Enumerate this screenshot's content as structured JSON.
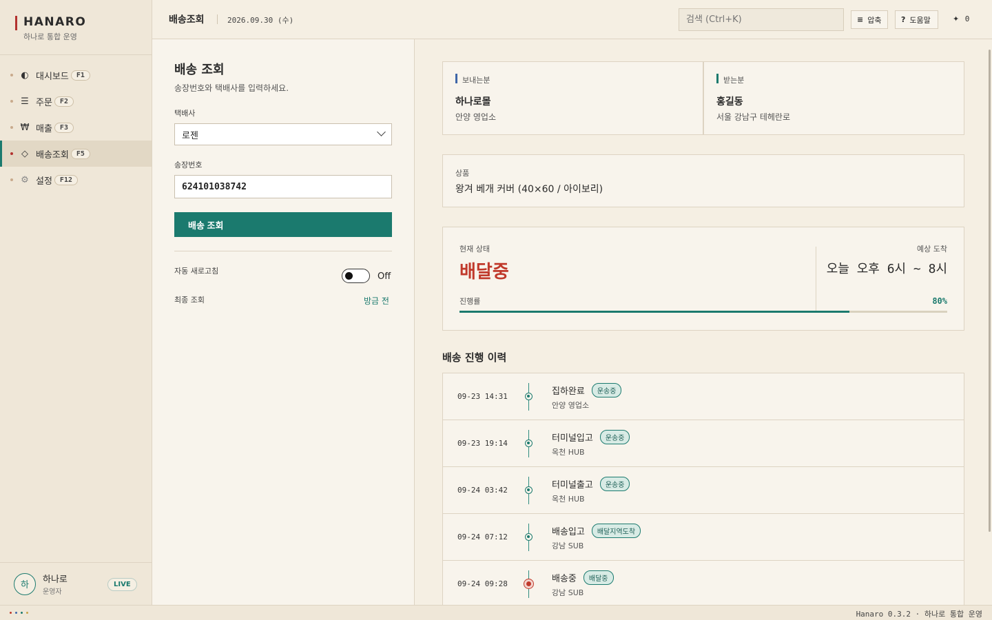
{
  "brand": {
    "name": "HANARO",
    "subtitle": "하나로 통합 운영"
  },
  "sidebar": {
    "items": [
      {
        "icon": "◐",
        "label": "대시보드",
        "key": "F1"
      },
      {
        "icon": "☰",
        "label": "주문",
        "key": "F2"
      },
      {
        "icon": "₩",
        "label": "매출",
        "key": "F3"
      },
      {
        "icon": "◇",
        "label": "배송조회",
        "key": "F5"
      },
      {
        "icon": "⚙",
        "label": "설정",
        "key": "F12"
      }
    ],
    "active_index": 3
  },
  "user": {
    "avatar": "하",
    "name": "하나로",
    "role": "운영자",
    "status": "LIVE"
  },
  "header": {
    "title": "배송조회",
    "date": "2026.09.30 (수)",
    "search_placeholder": "검색 (Ctrl+K)",
    "compress_icon": "≡",
    "compress_label": "압축",
    "help_icon": "?",
    "help_label": "도움말",
    "spark_icon": "✦",
    "spark_count": "0"
  },
  "form": {
    "title": "배송 조회",
    "description": "송장번호와 택배사를 입력하세요.",
    "carrier_label": "택배사",
    "carrier_value": "로젠",
    "tracking_label": "송장번호",
    "tracking_value": "624101038742",
    "submit_label": "배송 조회",
    "auto_refresh_label": "자동 새로고침",
    "auto_refresh_state": "Off",
    "last_query_label": "최종 조회",
    "last_query_value": "방금 전"
  },
  "sender": {
    "label": "보내는분",
    "name": "하나로몰",
    "address": "안양 영업소"
  },
  "receiver": {
    "label": "받는분",
    "name": "홍길동",
    "address": "서울 강남구 테헤란로"
  },
  "product": {
    "label": "상품",
    "name": "왕겨 베개 커버 (40×60 / 아이보리)"
  },
  "status": {
    "label": "현재 상태",
    "value": "배달중",
    "eta_label": "예상 도착",
    "eta_value": "오늘 오후 6시 ~ 8시",
    "progress_label": "진행률",
    "progress_text": "80%",
    "progress_percent": 80
  },
  "history": {
    "title": "배송 진행 이력",
    "items": [
      {
        "time": "09-23 14:31",
        "event": "집하완료",
        "tag": "운송중",
        "location": "안양 영업소",
        "current": false
      },
      {
        "time": "09-23 19:14",
        "event": "터미널입고",
        "tag": "운송중",
        "location": "옥천 HUB",
        "current": false
      },
      {
        "time": "09-24 03:42",
        "event": "터미널출고",
        "tag": "운송중",
        "location": "옥천 HUB",
        "current": false
      },
      {
        "time": "09-24 07:12",
        "event": "배송입고",
        "tag": "배달지역도착",
        "location": "강남 SUB",
        "current": false
      },
      {
        "time": "09-24 09:28",
        "event": "배송중",
        "tag": "배달중",
        "location": "강남 SUB",
        "current": true
      }
    ]
  },
  "footer": {
    "text": "Hanaro 0.3.2 · 하나로 통합 운영",
    "dot_colors": [
      "#c0392b",
      "#3e66a8",
      "#1b7a6e",
      "#c8a24a"
    ]
  },
  "colors": {
    "accent": "#1b7a6e",
    "brand": "#b3322f",
    "status": "#c0392b"
  }
}
